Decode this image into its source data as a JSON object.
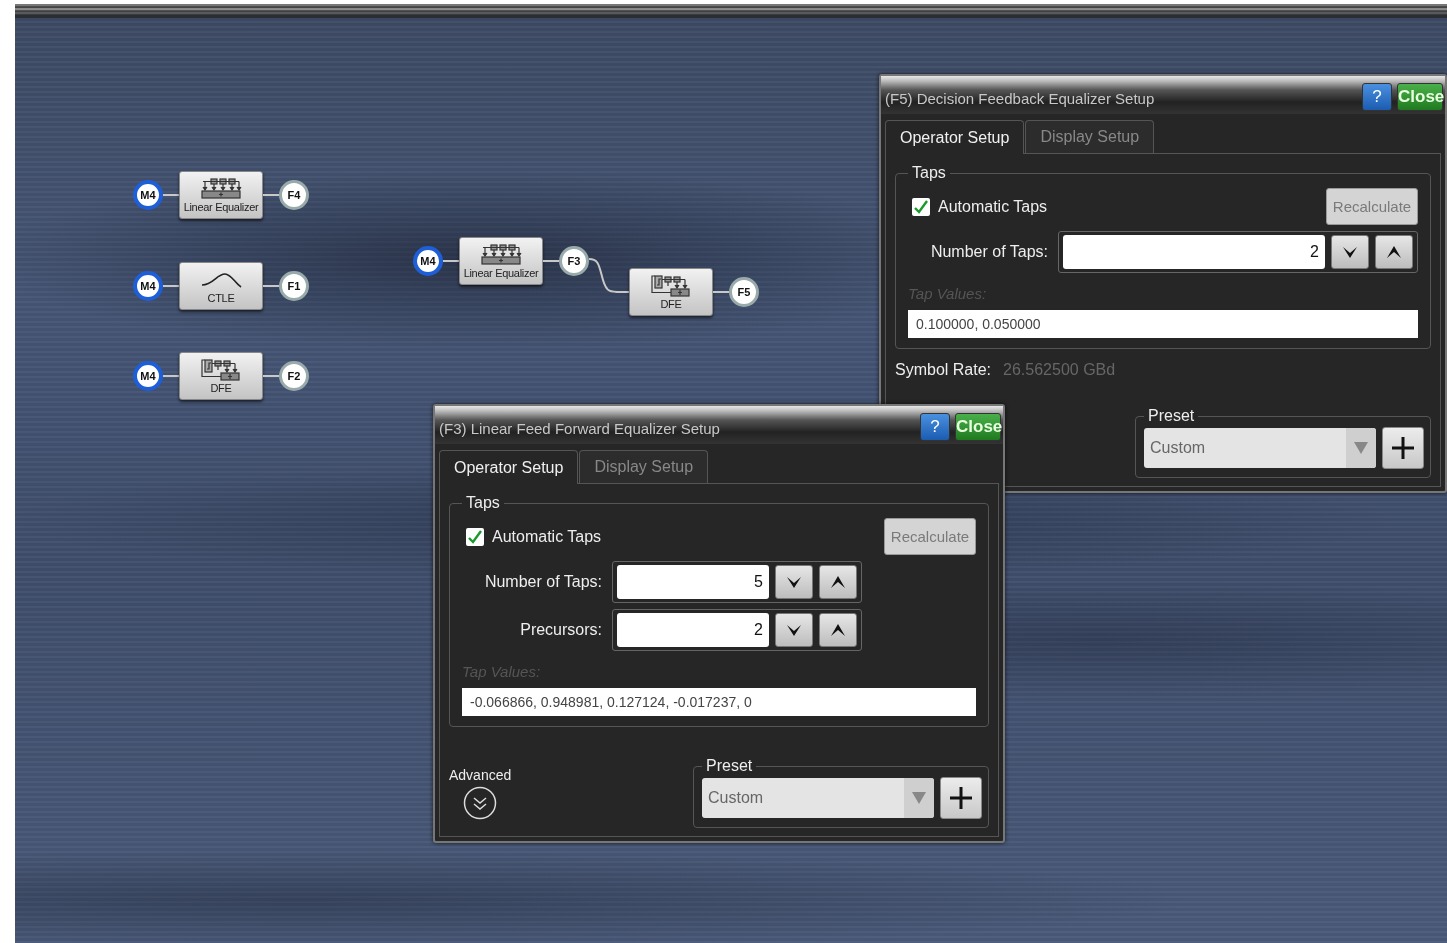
{
  "canvas": {
    "chains": [
      {
        "source": "M4",
        "stages": [
          {
            "kind": "linear",
            "label": "Linear Equalizer",
            "output": "F4"
          }
        ]
      },
      {
        "source": "M4",
        "stages": [
          {
            "kind": "ctle",
            "label": "CTLE",
            "output": "F1"
          }
        ]
      },
      {
        "source": "M4",
        "stages": [
          {
            "kind": "dfe",
            "label": "DFE",
            "output": "F2"
          }
        ]
      },
      {
        "source": "M4",
        "stages": [
          {
            "kind": "linear",
            "label": "Linear Equalizer",
            "output": "F3"
          },
          {
            "kind": "dfe",
            "label": "DFE",
            "output": "F5"
          }
        ]
      }
    ]
  },
  "dialogs": [
    {
      "title": "(F5) Decision Feedback Equalizer Setup",
      "help_button": "?",
      "close_button": "Close",
      "tabs": [
        {
          "label": "Operator Setup",
          "selected": true
        },
        {
          "label": "Display Setup",
          "selected": false
        }
      ],
      "taps": {
        "heading": "Taps",
        "automatic_taps": {
          "label": "Automatic Taps",
          "checked": true
        },
        "recalculate": {
          "label": "Recalculate",
          "disabled": true
        },
        "spinners": [
          {
            "label": "Number of Taps:",
            "value": "2"
          }
        ],
        "tap_values": {
          "label": "Tap Values:",
          "disabled": true,
          "value": "0.100000, 0.050000"
        }
      },
      "symbol_rate": {
        "label": "Symbol Rate:",
        "value": "26.562500 GBd"
      },
      "preset": {
        "heading": "Preset",
        "value": "Custom"
      }
    },
    {
      "title": "(F3) Linear Feed Forward Equalizer Setup",
      "help_button": "?",
      "close_button": "Close",
      "tabs": [
        {
          "label": "Operator Setup",
          "selected": true
        },
        {
          "label": "Display Setup",
          "selected": false
        }
      ],
      "taps": {
        "heading": "Taps",
        "automatic_taps": {
          "label": "Automatic Taps",
          "checked": true
        },
        "recalculate": {
          "label": "Recalculate",
          "disabled": true
        },
        "spinners": [
          {
            "label": "Number of Taps:",
            "value": "5"
          },
          {
            "label": "Precursors:",
            "value": "2"
          }
        ],
        "tap_values": {
          "label": "Tap Values:",
          "disabled": true,
          "value": "-0.066866, 0.948981, 0.127124, -0.017237, 0"
        }
      },
      "advanced": {
        "label": "Advanced"
      },
      "preset": {
        "heading": "Preset",
        "value": "Custom"
      }
    }
  ]
}
